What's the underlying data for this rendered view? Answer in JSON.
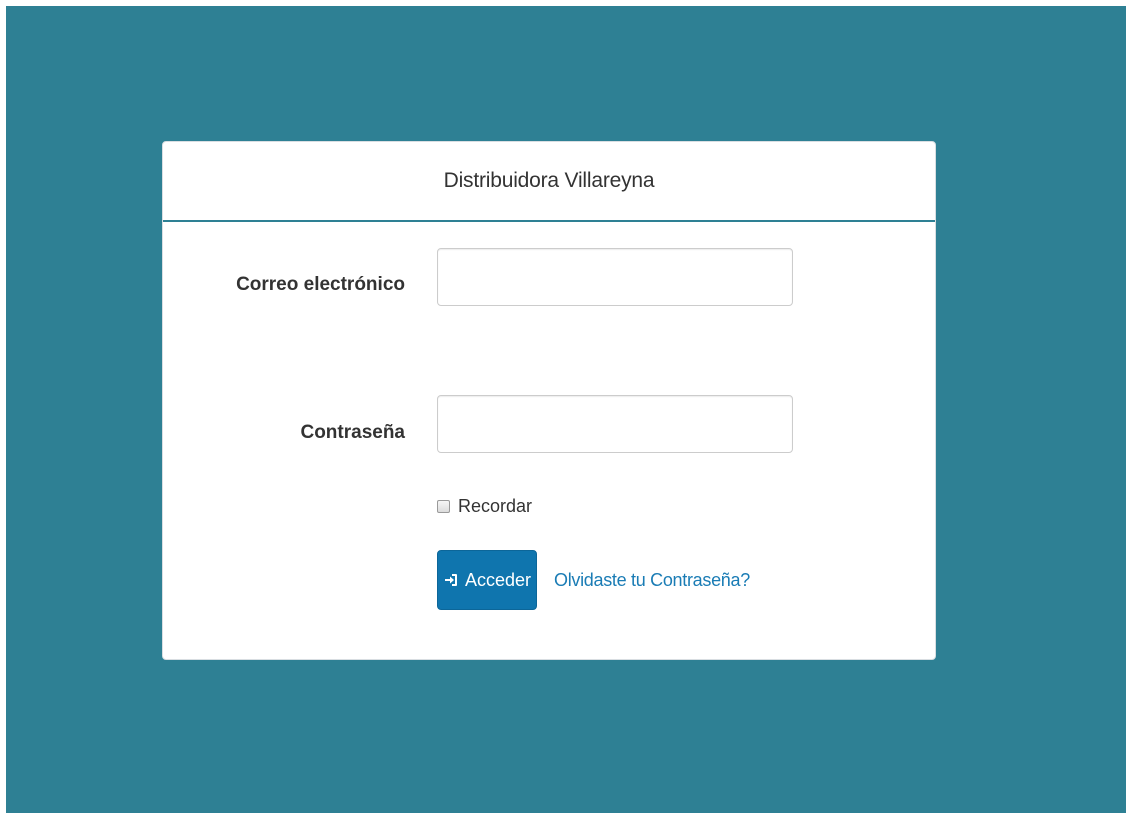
{
  "colors": {
    "background": "#2e8094",
    "panel": "#ffffff",
    "primary_button": "#0f75ae",
    "link": "#1a7cb5"
  },
  "panel": {
    "title": "Distribuidora Villareyna"
  },
  "form": {
    "email_label": "Correo electrónico",
    "email_value": "",
    "password_label": "Contraseña",
    "password_value": "",
    "remember_label": "Recordar",
    "remember_checked": false,
    "submit_label": "Acceder",
    "submit_icon": "login-icon",
    "forgot_link": "Olvidaste tu Contraseña?"
  }
}
